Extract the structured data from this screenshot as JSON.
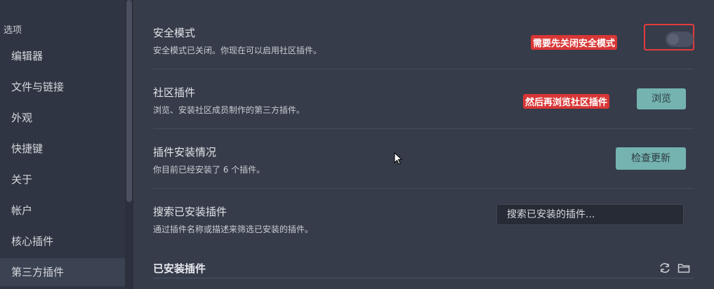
{
  "sidebar": {
    "section_label": "选项",
    "items": [
      {
        "label": "编辑器"
      },
      {
        "label": "文件与链接"
      },
      {
        "label": "外观"
      },
      {
        "label": "快捷键"
      },
      {
        "label": "关于"
      },
      {
        "label": "帐户"
      },
      {
        "label": "核心插件"
      },
      {
        "label": "第三方插件",
        "active": true
      }
    ]
  },
  "safe_mode": {
    "title": "安全模式",
    "description": "安全模式已关闭。你现在可以启用社区插件。",
    "annotation": "需要先关闭安全模式",
    "enabled": false
  },
  "community_plugins": {
    "title": "社区插件",
    "description": "浏览、安装社区成员制作的第三方插件。",
    "annotation": "然后再浏览社区插件",
    "button_label": "浏览"
  },
  "installed_status": {
    "title": "插件安装情况",
    "description": "你目前已经安装了 6 个插件。",
    "button_label": "检查更新"
  },
  "search_installed": {
    "title": "搜索已安装插件",
    "description": "通过插件名称或描述来筛选已安装的插件。",
    "placeholder": "搜索已安装的插件..."
  },
  "installed_section": {
    "heading": "已安装插件"
  },
  "colors": {
    "accent": "#74b3b0",
    "annotation": "#d93636",
    "background": "#363c4a",
    "sidebar": "#2f3543"
  },
  "icons": [
    "reload-icon",
    "folder-icon"
  ]
}
